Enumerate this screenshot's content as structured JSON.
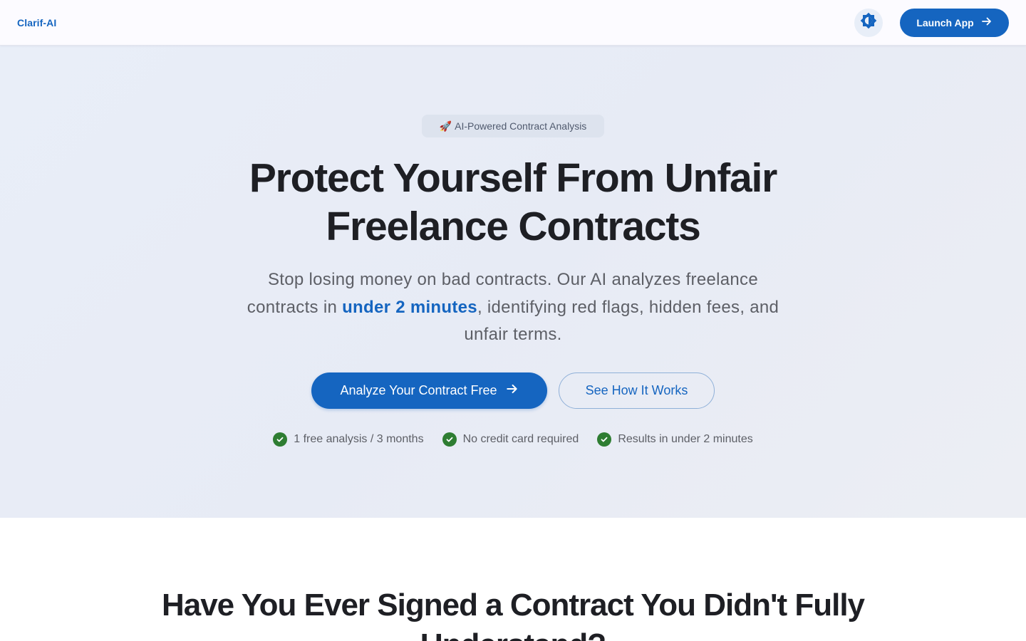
{
  "header": {
    "brand": "Clarif-AI",
    "theme_icon": "brightness-icon",
    "launch_label": "Launch App",
    "launch_icon": "arrow-right-icon"
  },
  "hero": {
    "badge": {
      "emoji": "🚀",
      "text": "AI-Powered Contract Analysis"
    },
    "title_line1": "Protect Yourself From Unfair",
    "title_line2": "Freelance Contracts",
    "subtitle_part1": "Stop losing money on bad contracts. Our AI analyzes freelance contracts in ",
    "subtitle_highlight": "under 2 minutes",
    "subtitle_part2": ", identifying red flags, hidden fees, and unfair terms.",
    "cta_primary": "Analyze Your Contract Free",
    "cta_secondary": "See How It Works",
    "features": [
      "1 free analysis / 3 months",
      "No credit card required",
      "Results in under 2 minutes"
    ]
  },
  "section": {
    "title": "Have You Ever Signed a Contract You Didn't Fully Understand?"
  },
  "colors": {
    "primary": "#1565c0",
    "success": "#2e7d32",
    "text": "#1e1f24",
    "muted": "#5d5f66"
  }
}
